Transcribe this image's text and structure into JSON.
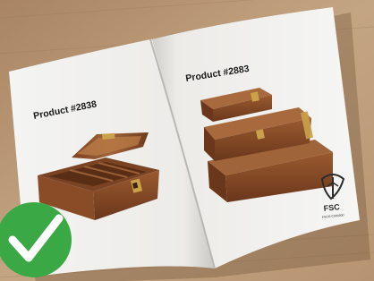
{
  "catalog": {
    "left_page": {
      "product_label": "Product #2838"
    },
    "right_page": {
      "product_label": "Product #2883"
    },
    "certification": {
      "logo_text": "FSC",
      "logo_subtext": "FSC® C000000"
    }
  },
  "badge": {
    "icon": "checkmark-icon",
    "color": "#3aa845"
  },
  "colors": {
    "table": "#c2a27e",
    "page": "#efefed",
    "wood_dark": "#6b3a1f",
    "wood_mid": "#8a4e2a",
    "wood_light": "#a86a3c",
    "brass": "#c9a24a"
  }
}
